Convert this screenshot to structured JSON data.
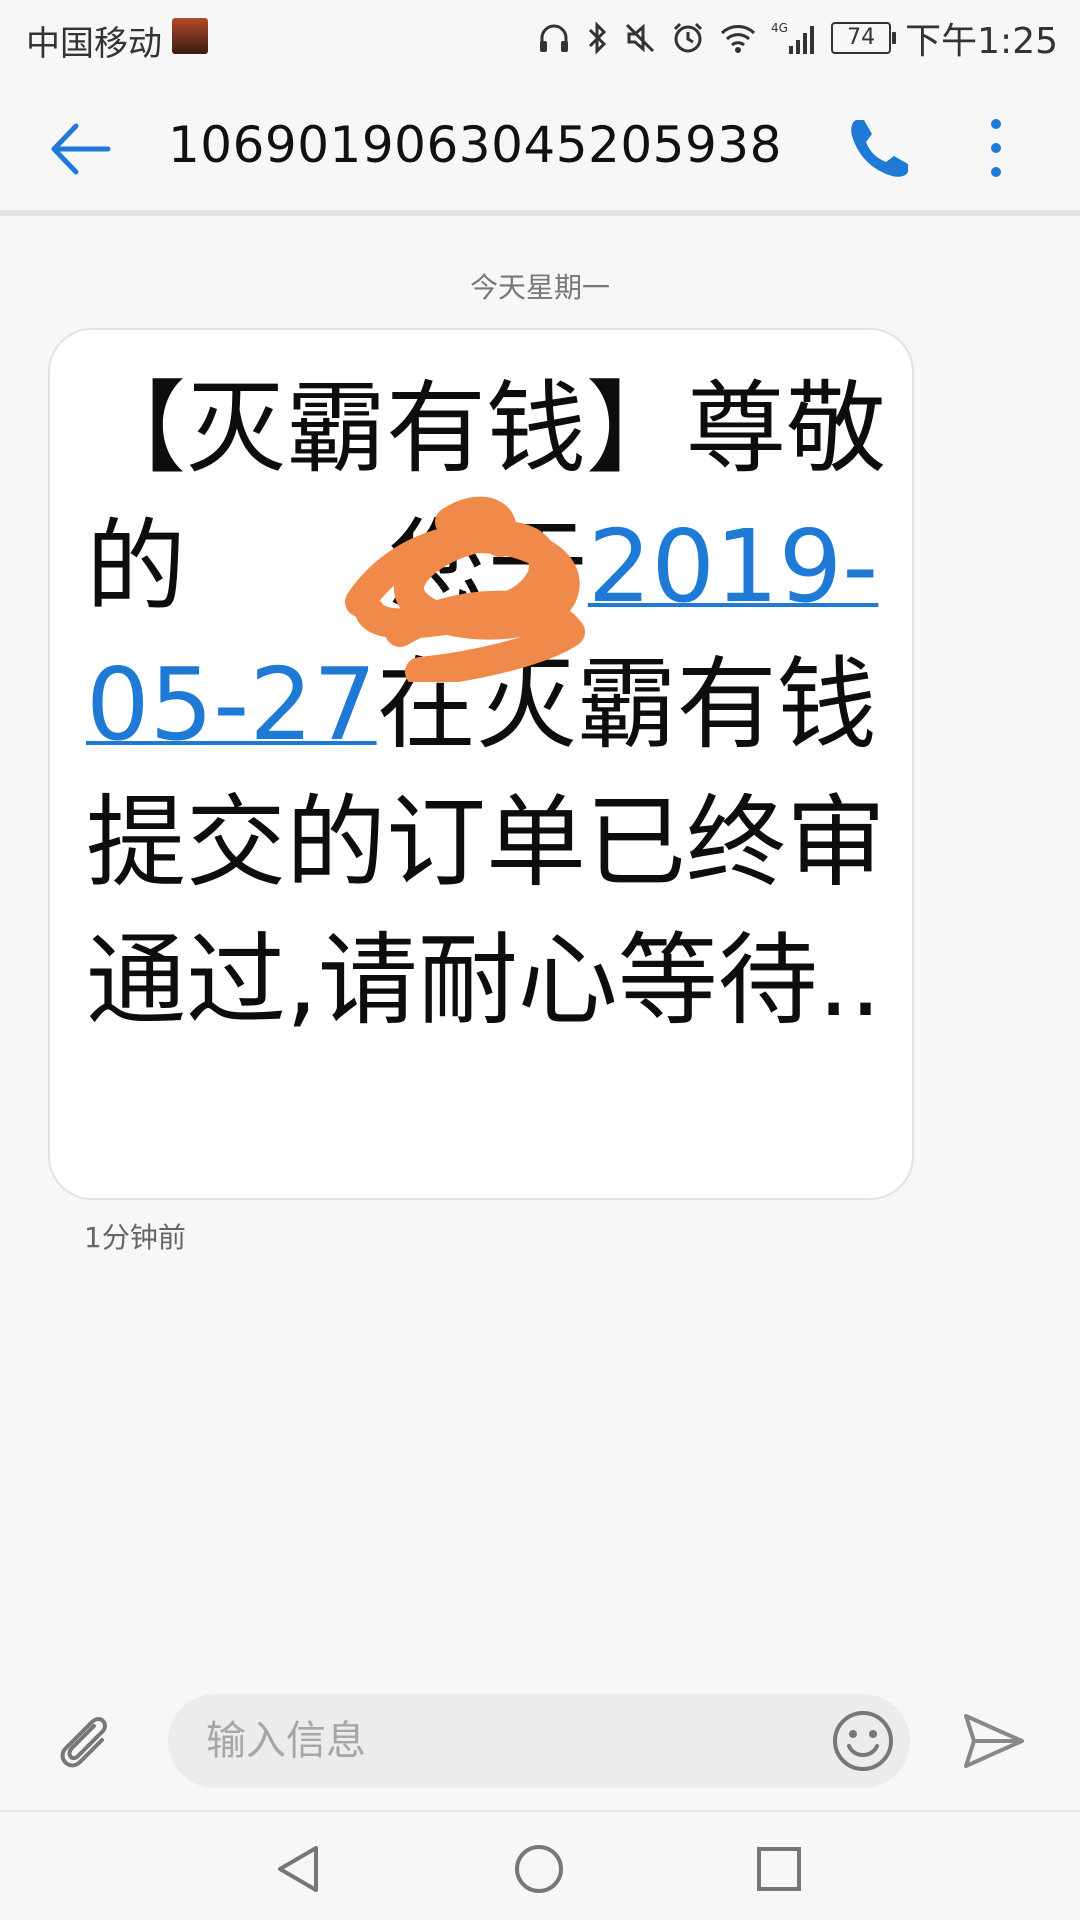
{
  "status_bar": {
    "carrier": "中国移动",
    "network": "4G",
    "battery": "74",
    "time": "下午1:25"
  },
  "header": {
    "title": "1069019063045205938",
    "back_icon": "arrow-left",
    "call_icon": "phone",
    "more_icon": "vertical-dots"
  },
  "conversation": {
    "date_label": "今天星期一",
    "message": {
      "text_before": "【灭霸有钱】尊敬的",
      "text_after_redaction": ",您于",
      "date_link": "2019-05-27",
      "text_end": "在灭霸有钱提交的订单已终审通过,请耐心等待..",
      "time": "1分钟前"
    }
  },
  "composer": {
    "placeholder": "输入信息",
    "attach_icon": "paperclip",
    "emoji_icon": "smiley",
    "send_icon": "send-arrow"
  },
  "nav_bar": {
    "back_icon": "triangle-back",
    "home_icon": "circle-home",
    "recent_icon": "square-recent"
  },
  "colors": {
    "accent": "#1f7ad6",
    "background": "#f7f7f7",
    "bubble": "#ffffff",
    "redaction": "#f08a4b"
  }
}
